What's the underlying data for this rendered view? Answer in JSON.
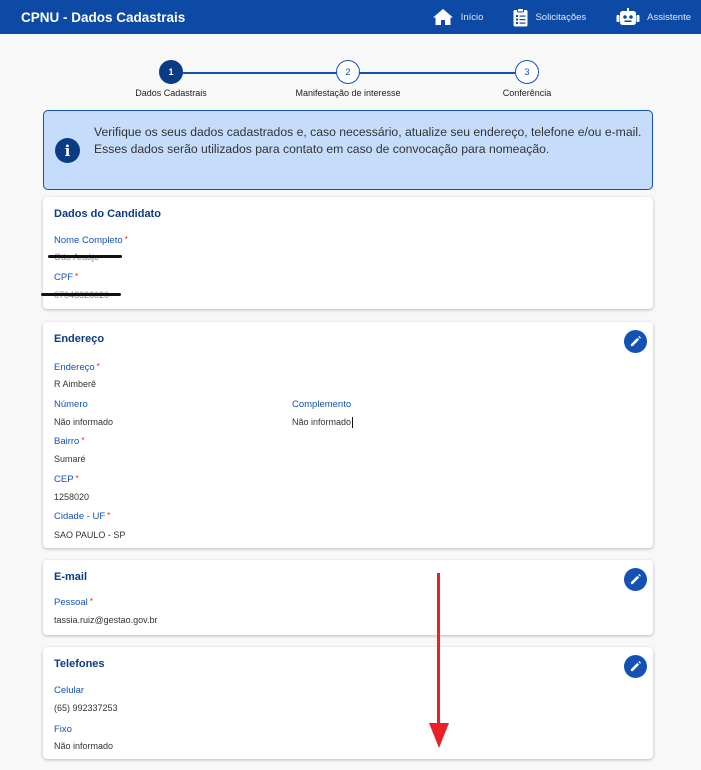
{
  "header": {
    "title": "CPNU - Dados Cadastrais",
    "nav": [
      {
        "label": "Início",
        "icon": "home-icon"
      },
      {
        "label": "Solicitações",
        "icon": "clipboard-icon"
      },
      {
        "label": "Assistente",
        "icon": "robot-icon"
      }
    ]
  },
  "stepper": {
    "steps": [
      {
        "number": "1",
        "label": "Dados Cadastrais",
        "active": true
      },
      {
        "number": "2",
        "label": "Manifestação de interesse",
        "active": false
      },
      {
        "number": "3",
        "label": "Conferência",
        "active": false
      }
    ]
  },
  "alert": {
    "line1": "Verifique os seus dados cadastrados e, caso necessário, atualize seu endereço, telefone e/ou e-mail.",
    "line2": "Esses dados serão utilizados para contato em caso de convocação para nomeação.",
    "icon": "info-icon"
  },
  "candidato": {
    "title": "Dados do Candidato",
    "nome_label": "Nome Completo",
    "nome_value": "Otto Araújo",
    "cpf_label": "CPF",
    "cpf_value": "07048828020"
  },
  "endereco": {
    "title": "Endereço",
    "endereco_label": "Endereço",
    "endereco_value": "R Aimberê",
    "numero_label": "Número",
    "numero_value": "Não informado",
    "complemento_label": "Complemento",
    "complemento_value": "Não informado",
    "bairro_label": "Bairro",
    "bairro_value": "Sumaré",
    "cep_label": "CEP",
    "cep_value": "1258020",
    "cidade_label": "Cidade - UF",
    "cidade_value": "SAO PAULO - SP"
  },
  "email": {
    "title": "E-mail",
    "pessoal_label": "Pessoal",
    "pessoal_value": "tassia.ruiz@gestao.gov.br"
  },
  "telefones": {
    "title": "Telefones",
    "celular_label": "Celular",
    "celular_value": "(65) 992337253",
    "fixo_label": "Fixo",
    "fixo_value": "Não informado"
  },
  "required_marker": "*",
  "colors": {
    "header_bg": "#0d4aa6",
    "primary": "#1351b4",
    "primary_dark": "#0c3b85",
    "alert_bg": "#c5dcfa",
    "required": "#e52207",
    "annotation_arrow": "#e8202a"
  }
}
